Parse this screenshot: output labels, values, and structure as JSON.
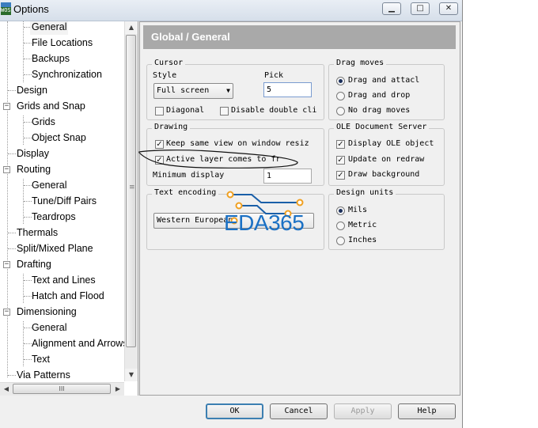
{
  "window": {
    "title": "Options",
    "app_icon_text": "WOS"
  },
  "tree": [
    {
      "label": "General",
      "selected": true
    },
    {
      "label": "File Locations"
    },
    {
      "label": "Backups"
    },
    {
      "label": "Synchronization"
    },
    {
      "label": "Design"
    },
    {
      "label": "Grids and Snap"
    },
    {
      "label": "Grids"
    },
    {
      "label": "Object Snap"
    },
    {
      "label": "Display"
    },
    {
      "label": "Routing"
    },
    {
      "label": "General"
    },
    {
      "label": "Tune/Diff Pairs"
    },
    {
      "label": "Teardrops"
    },
    {
      "label": "Thermals"
    },
    {
      "label": "Split/Mixed Plane"
    },
    {
      "label": "Drafting"
    },
    {
      "label": "Text and Lines"
    },
    {
      "label": "Hatch and Flood"
    },
    {
      "label": "Dimensioning"
    },
    {
      "label": "General"
    },
    {
      "label": "Alignment and Arrows"
    },
    {
      "label": "Text"
    },
    {
      "label": "Via Patterns"
    }
  ],
  "panel": {
    "title": "Global / General"
  },
  "cursor": {
    "group_title": "Cursor",
    "style_label": "Style",
    "style_value": "Full screen",
    "pick_label": "Pick",
    "pick_value": "5",
    "diagonal_label": "Diagonal",
    "diagonal_checked": false,
    "disable_dblclick_label": "Disable double cli",
    "disable_dblclick_checked": false
  },
  "drawing": {
    "group_title": "Drawing",
    "keep_view_label": "Keep same view on window resiz",
    "keep_view_checked": true,
    "active_layer_label": "Active layer comes to fr",
    "active_layer_checked": true,
    "min_display_label": "Minimum display",
    "min_display_value": "1"
  },
  "text_encoding": {
    "group_title": "Text encoding",
    "value": "Western European"
  },
  "drag_moves": {
    "group_title": "Drag moves",
    "options": [
      {
        "label": "Drag and attacl",
        "selected": true
      },
      {
        "label": "Drag and drop",
        "selected": false
      },
      {
        "label": "No drag moves",
        "selected": false
      }
    ]
  },
  "ole": {
    "group_title": "OLE Document Server",
    "options": [
      {
        "label": "Display OLE object",
        "checked": true
      },
      {
        "label": "Update on redraw",
        "checked": true
      },
      {
        "label": "Draw background",
        "checked": true
      }
    ]
  },
  "design_units": {
    "group_title": "Design units",
    "options": [
      {
        "label": "Mils",
        "selected": true
      },
      {
        "label": "Metric",
        "selected": false
      },
      {
        "label": "Inches",
        "selected": false
      }
    ]
  },
  "buttons": {
    "ok": "OK",
    "cancel": "Cancel",
    "apply": "Apply",
    "help": "Help"
  },
  "watermark": {
    "text": "EDA365",
    "color": "#1a70c4",
    "accent": "#f0a020"
  },
  "scrollbar": {
    "h_grip": "III"
  }
}
